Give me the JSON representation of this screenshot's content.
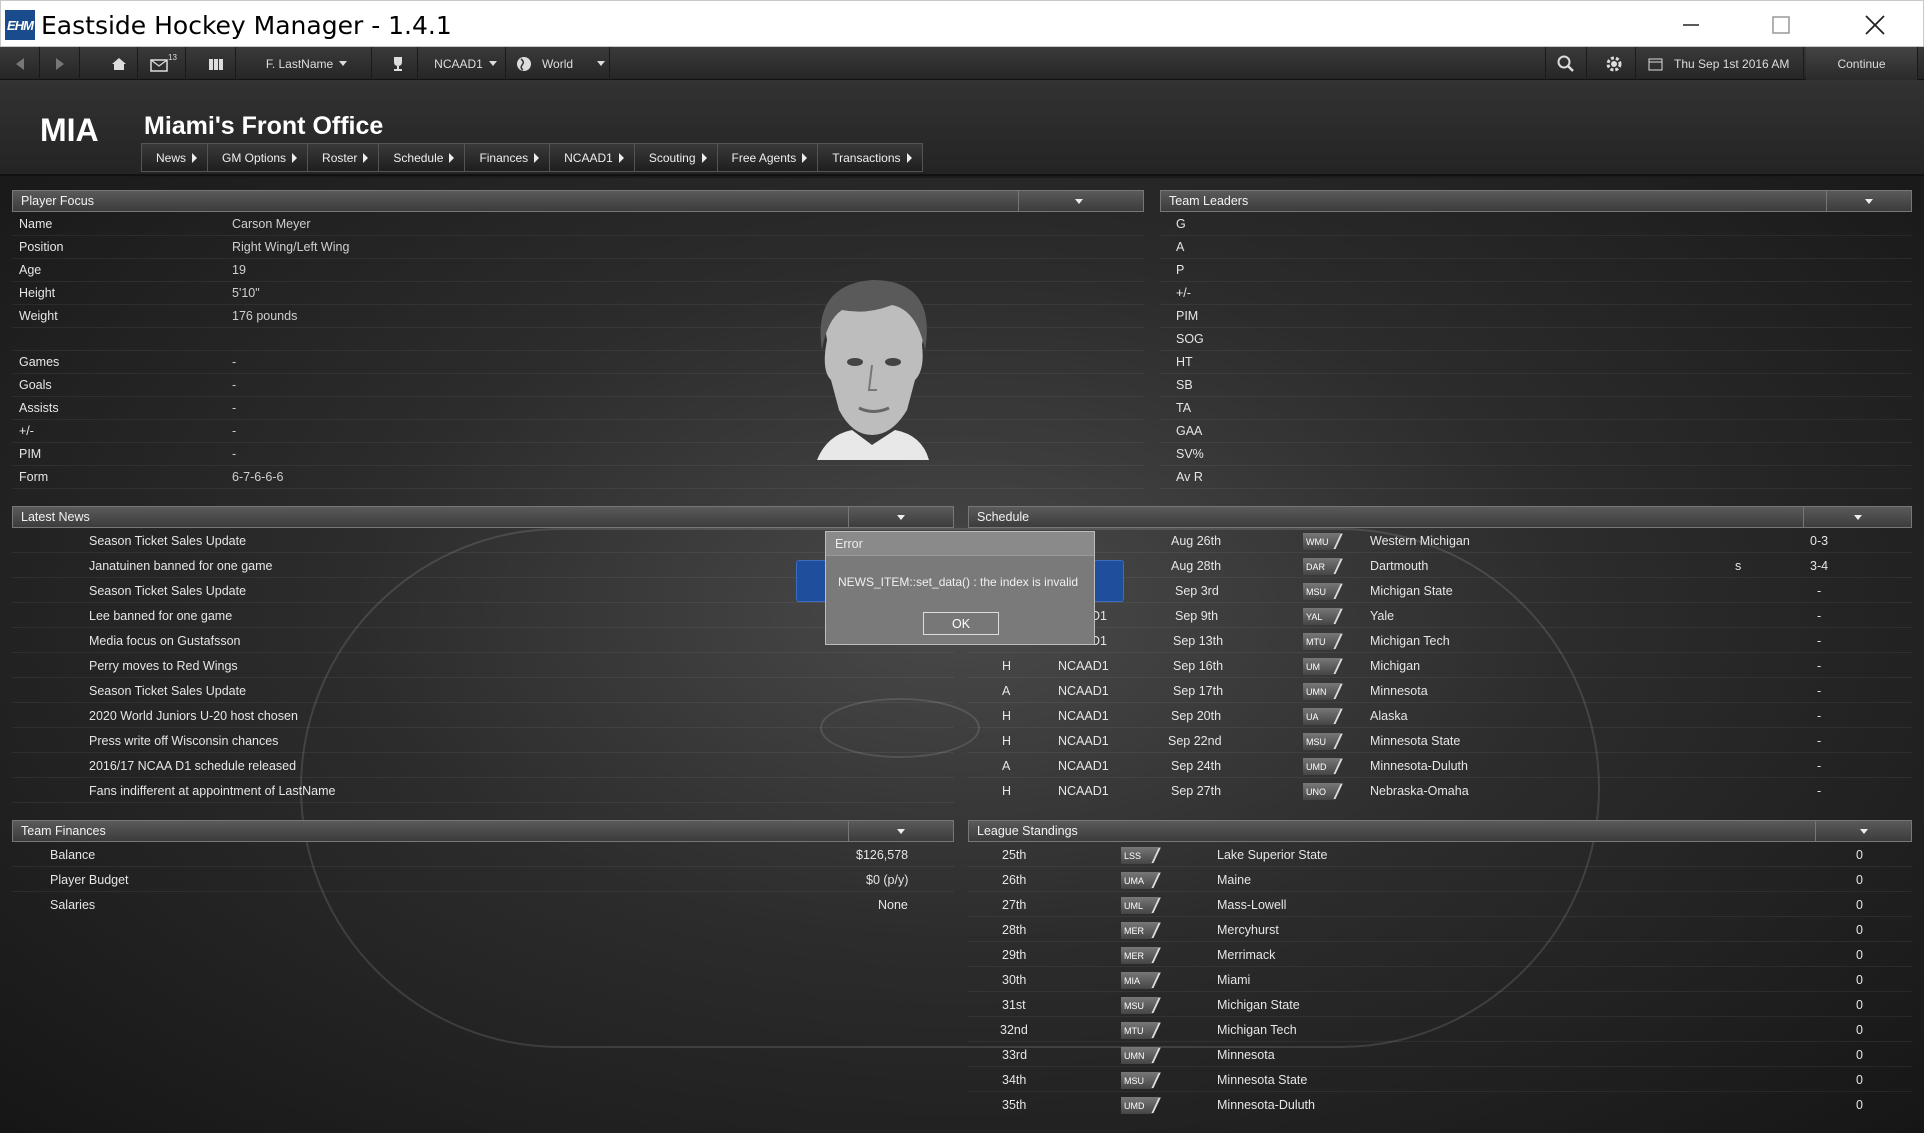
{
  "window": {
    "title": "Eastside Hockey Manager  -  1.4.1",
    "logo_text": "EHM"
  },
  "toolbar": {
    "inbox_count": "13",
    "user_name": "F. LastName",
    "league": "NCAAD1",
    "region": "World",
    "date": "Thu Sep 1st 2016 AM",
    "continue_label": "Continue"
  },
  "header": {
    "team_abbr": "MIA",
    "title": "Miami's Front Office",
    "nav": [
      "News",
      "GM Options",
      "Roster",
      "Schedule",
      "Finances",
      "NCAAD1",
      "Scouting",
      "Free Agents",
      "Transactions"
    ]
  },
  "player_focus": {
    "title": "Player Focus",
    "rows": [
      {
        "label": "Name",
        "value": "Carson Meyer"
      },
      {
        "label": "Position",
        "value": "Right Wing/Left Wing"
      },
      {
        "label": "Age",
        "value": "19"
      },
      {
        "label": "Height",
        "value": "5'10\""
      },
      {
        "label": "Weight",
        "value": "176 pounds"
      },
      {
        "label": "",
        "value": ""
      },
      {
        "label": "Games",
        "value": "-"
      },
      {
        "label": "Goals",
        "value": "-"
      },
      {
        "label": "Assists",
        "value": "-"
      },
      {
        "label": "+/-",
        "value": "-"
      },
      {
        "label": "PIM",
        "value": "-"
      },
      {
        "label": "Form",
        "value": "6-7-6-6-6"
      }
    ]
  },
  "team_leaders": {
    "title": "Team Leaders",
    "rows": [
      "G",
      "A",
      "P",
      "+/-",
      "PIM",
      "SOG",
      "HT",
      "SB",
      "TA",
      "GAA",
      "SV%",
      "Av R"
    ]
  },
  "latest_news": {
    "title": "Latest News",
    "items": [
      "Season Ticket Sales Update",
      "Janatuinen banned for one game",
      "Season Ticket Sales Update",
      "Lee banned for one game",
      "Media focus on Gustafsson",
      "Perry moves to Red Wings",
      "Season Ticket Sales Update",
      "2020 World Juniors U-20 host chosen",
      "Press write off Wisconsin chances",
      "2016/17 NCAA D1 schedule released",
      "Fans indifferent at appointment of LastName"
    ]
  },
  "schedule": {
    "title": "Schedule",
    "rows": [
      {
        "ha": "",
        "comp": "",
        "date": "Aug 26th",
        "logo": "WMU",
        "opponent": "Western Michigan",
        "flag": "",
        "result": "0-3"
      },
      {
        "ha": "",
        "comp": "",
        "date": "Aug 28th",
        "logo": "DAR",
        "opponent": "Dartmouth",
        "flag": "s",
        "result": "3-4"
      },
      {
        "ha": "",
        "comp": "",
        "date": "Sep 3rd",
        "logo": "MSU",
        "opponent": "Michigan State",
        "flag": "",
        "result": "-"
      },
      {
        "ha": "",
        "comp": "D1",
        "date": "Sep 9th",
        "logo": "YAL",
        "opponent": "Yale",
        "flag": "",
        "result": "-"
      },
      {
        "ha": "",
        "comp": "D1",
        "date": "Sep 13th",
        "logo": "MTU",
        "opponent": "Michigan Tech",
        "flag": "",
        "result": "-"
      },
      {
        "ha": "H",
        "comp": "NCAAD1",
        "date": "Sep 16th",
        "logo": "UM",
        "opponent": "Michigan",
        "flag": "",
        "result": "-"
      },
      {
        "ha": "A",
        "comp": "NCAAD1",
        "date": "Sep 17th",
        "logo": "UMN",
        "opponent": "Minnesota",
        "flag": "",
        "result": "-"
      },
      {
        "ha": "H",
        "comp": "NCAAD1",
        "date": "Sep 20th",
        "logo": "UA",
        "opponent": "Alaska",
        "flag": "",
        "result": "-"
      },
      {
        "ha": "H",
        "comp": "NCAAD1",
        "date": "Sep 22nd",
        "logo": "MSU",
        "opponent": "Minnesota State",
        "flag": "",
        "result": "-"
      },
      {
        "ha": "A",
        "comp": "NCAAD1",
        "date": "Sep 24th",
        "logo": "UMD",
        "opponent": "Minnesota-Duluth",
        "flag": "",
        "result": "-"
      },
      {
        "ha": "H",
        "comp": "NCAAD1",
        "date": "Sep 27th",
        "logo": "UNO",
        "opponent": "Nebraska-Omaha",
        "flag": "",
        "result": "-"
      }
    ]
  },
  "team_finances": {
    "title": "Team Finances",
    "rows": [
      {
        "label": "Balance",
        "value": "$126,578"
      },
      {
        "label": "Player Budget",
        "value": "$0 (p/y)"
      },
      {
        "label": "Salaries",
        "value": "None"
      }
    ]
  },
  "league_standings": {
    "title": "League Standings",
    "rows": [
      {
        "pos": "25th",
        "logo": "LSS",
        "team": "Lake Superior State",
        "pts": "0"
      },
      {
        "pos": "26th",
        "logo": "UMA",
        "team": "Maine",
        "pts": "0"
      },
      {
        "pos": "27th",
        "logo": "UML",
        "team": "Mass-Lowell",
        "pts": "0"
      },
      {
        "pos": "28th",
        "logo": "MER",
        "team": "Mercyhurst",
        "pts": "0"
      },
      {
        "pos": "29th",
        "logo": "MER",
        "team": "Merrimack",
        "pts": "0"
      },
      {
        "pos": "30th",
        "logo": "MIA",
        "team": "Miami",
        "pts": "0"
      },
      {
        "pos": "31st",
        "logo": "MSU",
        "team": "Michigan State",
        "pts": "0"
      },
      {
        "pos": "32nd",
        "logo": "MTU",
        "team": "Michigan Tech",
        "pts": "0"
      },
      {
        "pos": "33rd",
        "logo": "UMN",
        "team": "Minnesota",
        "pts": "0"
      },
      {
        "pos": "34th",
        "logo": "MSU",
        "team": "Minnesota State",
        "pts": "0"
      },
      {
        "pos": "35th",
        "logo": "UMD",
        "team": "Minnesota-Duluth",
        "pts": "0"
      }
    ]
  },
  "error_dialog": {
    "title": "Error",
    "message": "NEWS_ITEM::set_data() : the index is invalid",
    "ok_label": "OK"
  },
  "colors": {
    "dialog_bg": "#7a7a7a",
    "blue_banner": "#1f4f9c",
    "brand": "#1a4b8c"
  }
}
